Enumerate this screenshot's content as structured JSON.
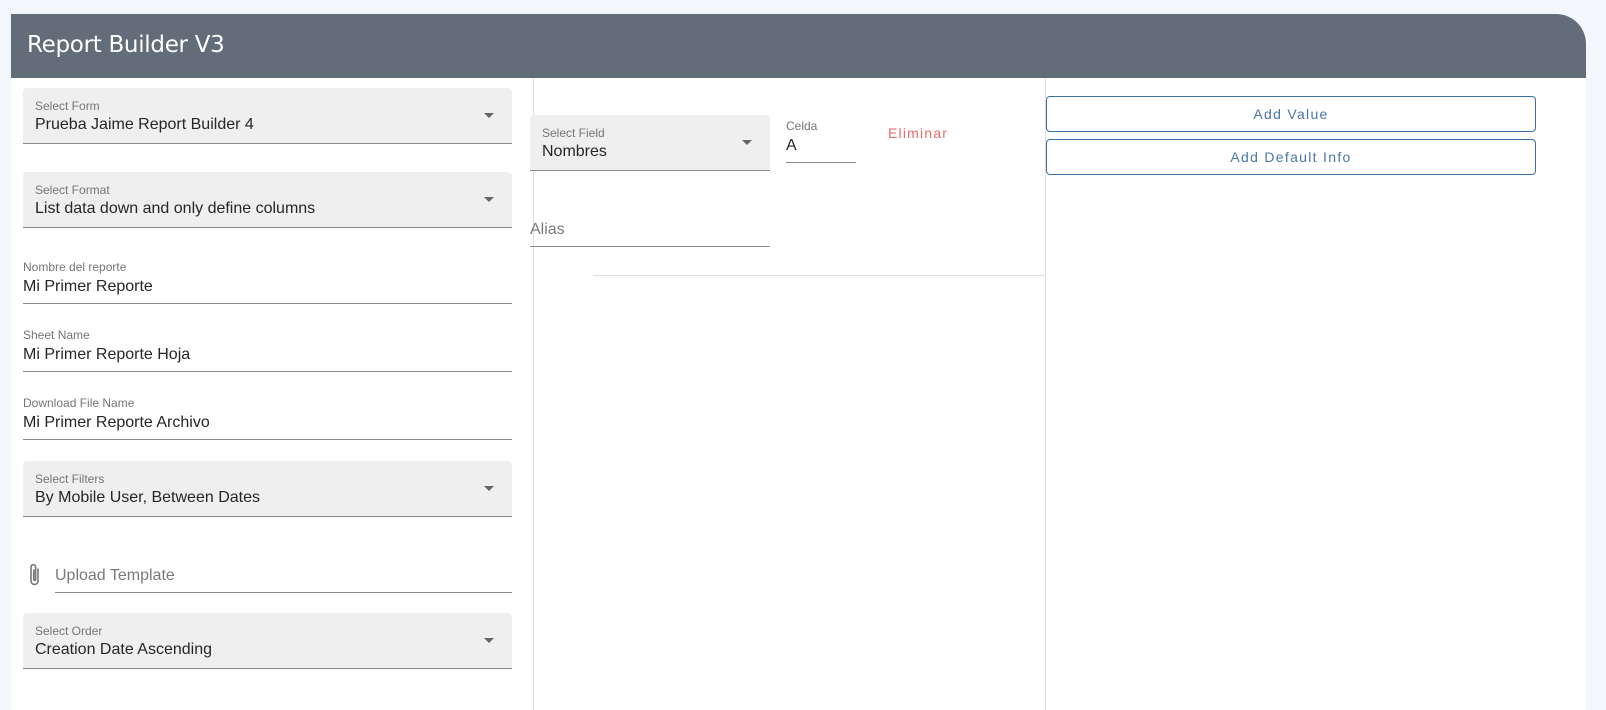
{
  "app": {
    "title": "Report Builder V3"
  },
  "form": {
    "select_form": {
      "label": "Select Form",
      "value": "Prueba Jaime Report Builder 4"
    },
    "select_format": {
      "label": "Select Format",
      "value": "List data down and only define columns"
    },
    "report_name": {
      "label": "Nombre del reporte",
      "value": "Mi Primer Reporte"
    },
    "sheet_name": {
      "label": "Sheet Name",
      "value": "Mi Primer Reporte Hoja"
    },
    "download_file_name": {
      "label": "Download File Name",
      "value": "Mi Primer Reporte Archivo"
    },
    "select_filters": {
      "label": "Select Filters",
      "value": "By Mobile User, Between Dates"
    },
    "upload_template": {
      "placeholder": "Upload Template"
    },
    "select_order": {
      "label": "Select Order",
      "value": "Creation Date Ascending"
    }
  },
  "column_row": {
    "select_field": {
      "label": "Select Field",
      "value": "Nombres"
    },
    "celda": {
      "label": "Celda",
      "value": "A"
    },
    "delete_label": "Eliminar",
    "alias": {
      "placeholder": "Alias"
    }
  },
  "actions": {
    "add_value_label": "Add Value",
    "add_default_info_label": "Add Default Info"
  },
  "icons": {
    "attach": "paperclip-icon",
    "dropdown": "caret-down-icon"
  },
  "colors": {
    "header_bg": "#626d79",
    "danger": "#e86a6a",
    "primary_outline": "#3a6ea5"
  }
}
